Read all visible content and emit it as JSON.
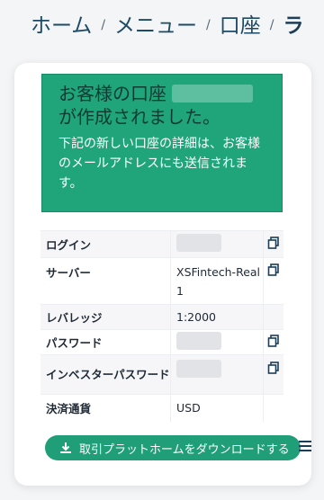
{
  "breadcrumb": {
    "items": [
      "ホーム",
      "メニュー",
      "口座",
      "ラ"
    ],
    "separator": "/"
  },
  "success_box": {
    "title_part1": "お客様の口座",
    "title_part2": "が作成されました。",
    "message": "下記の新しい口座の詳細は、お客様のメールアドレスにも送信されます。"
  },
  "details": {
    "rows": [
      {
        "label": "ログイン",
        "value": "",
        "copy": true,
        "redacted": true
      },
      {
        "label": "サーバー",
        "value": "XSFintech-Real1",
        "copy": true,
        "redacted": false
      },
      {
        "label": "レバレッジ",
        "value": "1:2000",
        "copy": false,
        "redacted": false
      },
      {
        "label": "パスワード",
        "value": "",
        "copy": true,
        "redacted": true
      },
      {
        "label": "インベスターパスワード",
        "value": "",
        "copy": true,
        "redacted": true
      },
      {
        "label": "決済通貨",
        "value": "USD",
        "copy": false,
        "redacted": false
      }
    ]
  },
  "download": {
    "label": "取引プラットホームをダウンロードする",
    "icon": "download-icon"
  },
  "colors": {
    "accent": "#20a47a",
    "button": "#1f9e77",
    "link": "#1d4a66"
  }
}
